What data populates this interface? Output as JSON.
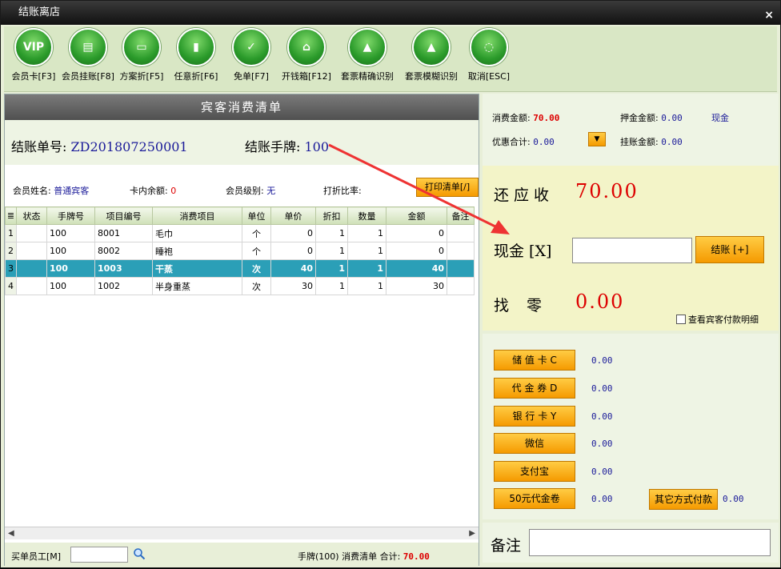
{
  "window": {
    "title": "结账离店",
    "close": "×"
  },
  "toolbar": [
    {
      "label": "会员卡[F3]",
      "icon": "vip-icon",
      "glyph": "VIP"
    },
    {
      "label": "会员挂账[F8]",
      "icon": "member-ledger-icon",
      "glyph": "▤"
    },
    {
      "label": "方案折[F5]",
      "icon": "plan-discount-icon",
      "glyph": "▭"
    },
    {
      "label": "任意折[F6]",
      "icon": "any-discount-icon",
      "glyph": "▮"
    },
    {
      "label": "免单[F7]",
      "icon": "free-order-icon",
      "glyph": "✓"
    },
    {
      "label": "开钱箱[F12]",
      "icon": "cash-drawer-icon",
      "glyph": "⌂"
    },
    {
      "label": "套票精确识别",
      "icon": "ticket-exact-icon",
      "glyph": "▲"
    },
    {
      "label": "套票模糊识别",
      "icon": "ticket-fuzzy-icon",
      "glyph": "▲"
    },
    {
      "label": "取消[ESC]",
      "icon": "cancel-icon",
      "glyph": "◌"
    }
  ],
  "bill": {
    "list_title": "宾客消费清单",
    "no_label": "结账单号:",
    "no": "ZD201807250001",
    "tag_label": "结账手牌:",
    "tag": "100"
  },
  "member": {
    "name_label": "会员姓名:",
    "name": "普通宾客",
    "balance_label": "卡内余额:",
    "balance": "0",
    "level_label": "会员级别:",
    "level": "无",
    "discount_label": "打折比率:",
    "print_button": "打印清单[/]"
  },
  "grid": {
    "columns": [
      "状态",
      "手牌号",
      "项目编号",
      "消费项目",
      "单位",
      "单价",
      "折扣",
      "数量",
      "金额",
      "备注"
    ],
    "rows": [
      {
        "idx": "1",
        "status": "",
        "tag": "100",
        "code": "8001",
        "item": "毛巾",
        "unit": "个",
        "price": "0",
        "discount": "1",
        "qty": "1",
        "amount": "0",
        "note": ""
      },
      {
        "idx": "2",
        "status": "",
        "tag": "100",
        "code": "8002",
        "item": "睡袍",
        "unit": "个",
        "price": "0",
        "discount": "1",
        "qty": "1",
        "amount": "0",
        "note": ""
      },
      {
        "idx": "3",
        "status": "",
        "tag": "100",
        "code": "1003",
        "item": "干蒸",
        "unit": "次",
        "price": "40",
        "discount": "1",
        "qty": "1",
        "amount": "40",
        "note": ""
      },
      {
        "idx": "4",
        "status": "",
        "tag": "100",
        "code": "1002",
        "item": "半身重蒸",
        "unit": "次",
        "price": "30",
        "discount": "1",
        "qty": "1",
        "amount": "30",
        "note": ""
      }
    ]
  },
  "footer": {
    "staff_label": "买单员工[M]",
    "summary": "手牌(100) 消费清单 合计:",
    "total": "70.00"
  },
  "summary": {
    "consume_label": "消费金额:",
    "consume": "70.00",
    "deposit_label": "押金金额:",
    "deposit": "0.00",
    "deposit_type": "现金",
    "discount_label": "优惠合计:",
    "discount": "0.00",
    "credit_label": "挂账金额:",
    "credit": "0.00"
  },
  "payment": {
    "due_label": "还应收",
    "due": "70.00",
    "cash_label": "现金 [X]",
    "settle_button": "结账 [+]",
    "change_label": "找零",
    "change": "0.00",
    "detail_check": "查看宾客付款明细"
  },
  "methods": [
    {
      "label": "储 值 卡 C",
      "value": "0.00"
    },
    {
      "label": "代 金 券 D",
      "value": "0.00"
    },
    {
      "label": "银 行 卡 Y",
      "value": "0.00"
    },
    {
      "label": "微信",
      "value": "0.00"
    },
    {
      "label": "支付宝",
      "value": "0.00"
    },
    {
      "label": "50元代金卷",
      "value": "0.00"
    }
  ],
  "other": {
    "label": "其它方式付款",
    "value": "0.00"
  },
  "notes": {
    "label": "备注"
  },
  "colors": {
    "accent": "#f59a00",
    "amount_red": "#dd0000",
    "link_blue": "#1a1a99",
    "selected_row": "#2b9fb7"
  }
}
